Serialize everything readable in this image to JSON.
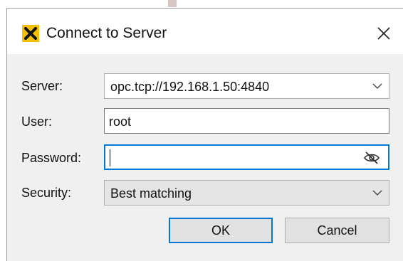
{
  "window": {
    "title": "Connect to Server",
    "app_icon": "x-logo-icon",
    "close_icon": "close-icon"
  },
  "form": {
    "server": {
      "label": "Server:",
      "value": "opc.tcp://192.168.1.50:4840",
      "icon": "chevron-down-icon"
    },
    "user": {
      "label": "User:",
      "value": "root"
    },
    "password": {
      "label": "Password:",
      "value": "",
      "icon": "eye-slash-icon"
    },
    "security": {
      "label": "Security:",
      "value": "Best matching",
      "icon": "chevron-down-icon"
    }
  },
  "buttons": {
    "ok_label": "OK",
    "cancel_label": "Cancel"
  },
  "colors": {
    "accent": "#0078d7",
    "icon_bg": "#f5c000",
    "client_bg": "#f0f0f0"
  }
}
